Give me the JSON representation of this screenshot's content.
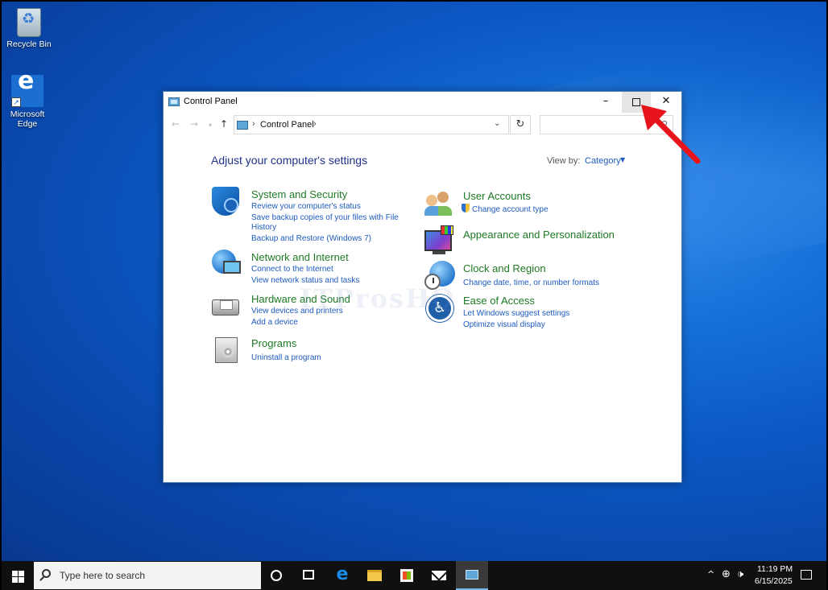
{
  "desktop": {
    "icons": [
      {
        "label": "Recycle Bin",
        "icon": "recycle-bin-icon"
      },
      {
        "label": "Microsoft Edge",
        "icon": "edge-icon"
      }
    ],
    "watermark": "ITProsHQ"
  },
  "window": {
    "title": "Control Panel",
    "buttons": {
      "minimize": "–",
      "maximize": "maximize",
      "close": "✕"
    },
    "address": {
      "breadcrumb": "Control Panel",
      "separator": "›"
    },
    "search": {
      "placeholder": ""
    },
    "heading": "Adjust your computer's settings",
    "view_by": {
      "label": "View by:",
      "value": "Category"
    },
    "categories": [
      {
        "title": "System and Security",
        "icon": "security-shield-icon",
        "links": [
          "Review your computer's status",
          "Save backup copies of your files with File",
          "History",
          "Backup and Restore (Windows 7)"
        ]
      },
      {
        "title": "Network and Internet",
        "icon": "network-globe-icon",
        "links": [
          "Connect to the Internet",
          "View network status and tasks"
        ]
      },
      {
        "title": "Hardware and Sound",
        "icon": "printer-icon",
        "links": [
          "View devices and printers",
          "Add a device"
        ]
      },
      {
        "title": "Programs",
        "icon": "programs-disc-icon",
        "links": [
          "Uninstall a program"
        ]
      },
      {
        "title": "User Accounts",
        "icon": "users-icon",
        "links": [
          "Change account type"
        ]
      },
      {
        "title": "Appearance and Personalization",
        "icon": "monitor-palette-icon",
        "links": []
      },
      {
        "title": "Clock and Region",
        "icon": "clock-globe-icon",
        "links": [
          "Change date, time, or number formats"
        ]
      },
      {
        "title": "Ease of Access",
        "icon": "ease-of-access-icon",
        "links": [
          "Let Windows suggest settings",
          "Optimize visual display"
        ]
      }
    ]
  },
  "annotation": {
    "color": "#e8141b",
    "icon": "red-arrow-icon"
  },
  "taskbar": {
    "search_placeholder": "Type here to search",
    "time": "11:19 PM",
    "date": "6/15/2025",
    "pinned": [
      "cortana-icon",
      "task-view-icon",
      "edge-icon",
      "file-explorer-icon",
      "store-icon",
      "mail-icon",
      "control-panel-icon"
    ],
    "tray_caret": "^"
  }
}
